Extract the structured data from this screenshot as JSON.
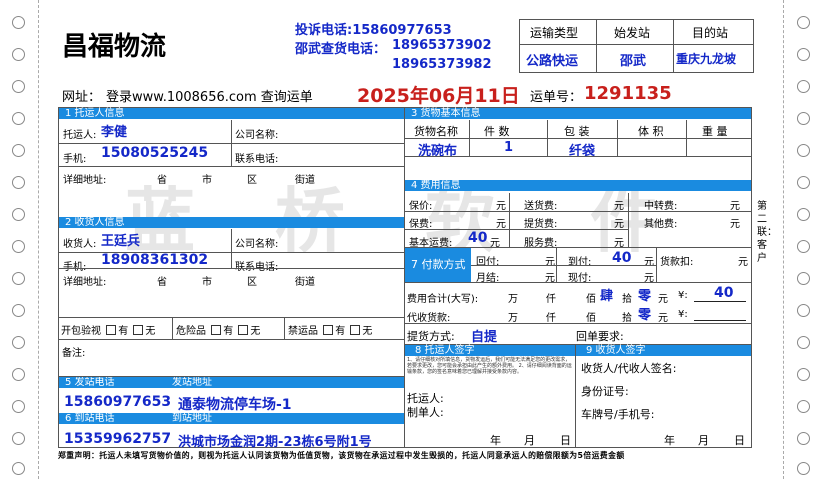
{
  "company": "昌福物流",
  "complaint_phone": "投诉电话:15860977653",
  "inquiry_label": "邵武查货电话：",
  "inquiry_phone1": "18965373902",
  "inquiry_phone2": "18965373982",
  "website_prefix": "网址：",
  "website_text": "登录www.1008656.com 查询运单",
  "date": "2025年06月11日",
  "waybill_label": "运单号：",
  "waybill_no": "1291135",
  "route": {
    "h_type": "运输类型",
    "h_start": "始发站",
    "h_dest": "目的站",
    "type": "公路快运",
    "start": "邵武",
    "dest": "重庆九龙坡"
  },
  "sender": {
    "title": "1 托运人信息",
    "name_label": "托运人:",
    "name": "李健",
    "company_label": "公司名称:",
    "phone_label": "手机:",
    "phone": "15080525245",
    "tel_label": "联系电话:",
    "addr_label": "详细地址:",
    "prov": "省",
    "city": "市",
    "dist": "区",
    "street": "街道"
  },
  "receiver": {
    "title": "2 收货人信息",
    "name_label": "收货人:",
    "name": "王廷兵",
    "company_label": "公司名称:",
    "phone_label": "手机:",
    "phone": "18908361302",
    "tel_label": "联系电话:",
    "addr_label": "详细地址:",
    "prov": "省",
    "city": "市",
    "dist": "区",
    "street": "街道"
  },
  "check": {
    "open_label": "开包验视",
    "yes": "有",
    "no": "无",
    "danger_label": "危险品",
    "forbid_label": "禁运品",
    "note_label": "备注:"
  },
  "goods": {
    "title": "3 货物基本信息",
    "h_name": "货物名称",
    "h_count": "件 数",
    "h_pack": "包 装",
    "h_vol": "体 积",
    "h_weight": "重 量",
    "name": "洗碗布",
    "count": "1",
    "pack": "纤袋"
  },
  "fees": {
    "title": "4 费用信息",
    "insure": "保价:",
    "yuan": "元",
    "deliver": "送货费:",
    "transit": "中转费:",
    "premium": "保费:",
    "pickup": "提货费:",
    "other": "其他费:",
    "base": "基本运费:",
    "base_value": "40",
    "service": "服务费:"
  },
  "payment": {
    "title": "7 付款方式",
    "now": "回付:",
    "arrive": "到付:",
    "arrive_value": "40",
    "deduct": "货款扣:",
    "monthly": "月结:",
    "cash": "现付:",
    "total_label": "费用合计(大写):",
    "wan": "万",
    "qian": "仟",
    "bai": "佰",
    "bai_value": "肆",
    "shi": "拾",
    "shi_value": "零",
    "yuan": "元",
    "yen": "¥:",
    "total": "40",
    "cod_label": "代收货款:",
    "cod_shi_value": "零"
  },
  "pickup": {
    "method_label": "提货方式:",
    "method": "自提",
    "receipt_label": "回单要求:"
  },
  "sign": {
    "sender_title": "8 托运人签字",
    "receiver_title": "9 收货人签字",
    "terms": "1、请仔细核对所填信息，货物发运后，我们可能无法满足您的更改需求，若要求更改，您可能会承担由此产生的额外费用。 2、请仔细阅读背面的运输条款，您的签名意味着您已理解并接受条款内容。",
    "shipper": "托运人:",
    "maker": "制单人:",
    "recv_name": "收货人/代收人签名:",
    "id": "身份证号:",
    "plate": "车牌号/手机号:",
    "year": "年",
    "month": "月",
    "day": "日"
  },
  "start_station": {
    "phone_title": "5 发站电话",
    "addr_title": "发站地址",
    "phone": "15860977653",
    "addr": "通泰物流停车场-1"
  },
  "dest_station": {
    "phone_title": "6 到站电话",
    "addr_title": "到站地址",
    "phone": "15359962757",
    "addr": "洪城市场金润2期-23栋6号附1号"
  },
  "disclaimer": "郑重声明：托运人未填写货物价值的，则视为托运人认同该货物为低值货物，该货物在承运过程中发生毁损的，托运人同意承运人的赔偿限额为5倍运费金额",
  "side_label": "第二联：客户",
  "watermark": [
    "蓝",
    "桥",
    "软",
    "件"
  ]
}
